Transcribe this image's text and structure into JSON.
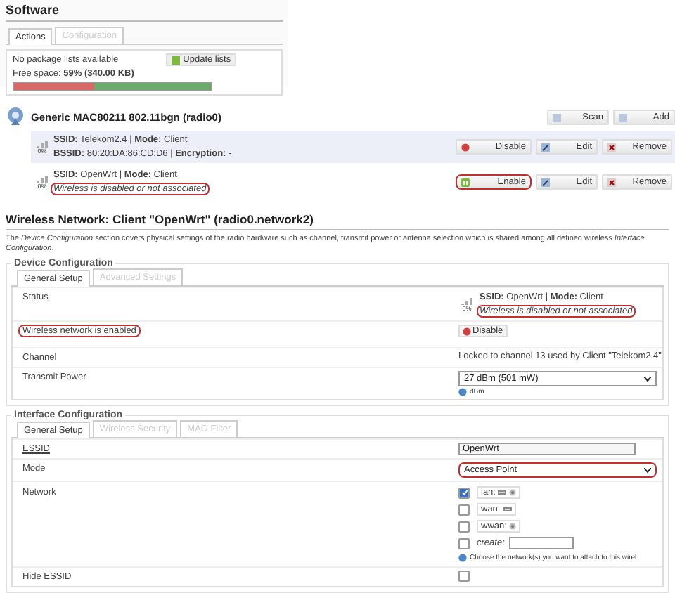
{
  "software": {
    "title": "Software",
    "tabs": [
      {
        "label": "Actions",
        "selected": true
      },
      {
        "label": "Configuration",
        "selected": false
      }
    ],
    "package_status": "No package lists available",
    "update_button": "Update lists",
    "free_space": {
      "label": "Free space:",
      "value": "59%",
      "detail": "(340.00 KB)",
      "level": 0.59
    }
  },
  "radio": {
    "title": "Generic MAC80211 802.11bgn (radio0)",
    "buttons": [
      {
        "label": "Scan"
      },
      {
        "label": "Add"
      }
    ],
    "networks": [
      {
        "signal": "0%",
        "summary": "**SSID:** Telekom2.4 | **Mode:** Client",
        "kind": "associated",
        "detail": "**BSSID:** 80:20:DA:86:CD:D6 | **Encryption:** -",
        "detail_highlighted": false,
        "toggle": {
          "kind": "disable",
          "label": "Disable",
          "highlighted": false
        },
        "edit": "Edit",
        "remove": "Remove"
      },
      {
        "signal": "0%",
        "summary": "**SSID:** OpenWrt | **Mode:** Client",
        "kind": "disabled",
        "detail": "Wireless is disabled or not associated",
        "detail_highlighted": true,
        "toggle": {
          "kind": "enable",
          "label": "Enable",
          "highlighted": true
        },
        "edit": "Edit",
        "remove": "Remove"
      }
    ]
  },
  "wireless": {
    "title": "Wireless Network: Client \"OpenWrt\" (radio0.network2)",
    "description": "The *Device Configuration* section covers physical settings of the radio hardware such as channel, transmit power or antenna selection which is shared among all defined wireless *Interface Configuration*.",
    "device": {
      "legend": "Device Configuration",
      "tabs": [
        {
          "label": "General Setup",
          "selected": true
        },
        {
          "label": "Advanced Settings",
          "selected": false
        }
      ],
      "rows": [
        {
          "kind": "status",
          "label": "Status",
          "signal": "0%",
          "summary": "**SSID:** OpenWrt | **Mode:** Client",
          "message": "Wireless is disabled or not associated",
          "highlighted": true
        },
        {
          "kind": "toggle",
          "label": "Wireless network is enabled",
          "highlighted": true,
          "button": "Disable"
        },
        {
          "kind": "text",
          "label": "Channel",
          "value": "Locked to channel 13 used by Client \"Telekom2.4\""
        },
        {
          "kind": "select",
          "label": "Transmit Power",
          "value": "27 dBm (501 mW)",
          "hint": "dBm",
          "highlighted": false
        }
      ]
    },
    "interface": {
      "legend": "Interface Configuration",
      "tabs": [
        {
          "label": "General Setup",
          "selected": true
        },
        {
          "label": "Wireless Security",
          "selected": false
        },
        {
          "label": "MAC-Filter",
          "selected": false
        }
      ],
      "rows": [
        {
          "kind": "input",
          "label": "ESSID",
          "value": "OpenWrt"
        },
        {
          "kind": "select",
          "label": "Mode",
          "value": "Access Point",
          "highlighted": true
        },
        {
          "kind": "networks",
          "label": "Network",
          "options": [
            {
              "kind": "interface",
              "label": "lan:",
              "checked": true,
              "wired": true,
              "wireless": true
            },
            {
              "kind": "interface",
              "label": "wan:",
              "checked": false,
              "wired": true,
              "wireless": false
            },
            {
              "kind": "interface",
              "label": "wwan:",
              "checked": false,
              "wired": false,
              "wireless": true
            },
            {
              "kind": "create",
              "label": "create:",
              "checked": false
            }
          ],
          "hint": "Choose the network(s) you want to attach to this wirel"
        },
        {
          "kind": "checkbox",
          "label": "Hide ESSID",
          "checked": false
        }
      ]
    }
  }
}
